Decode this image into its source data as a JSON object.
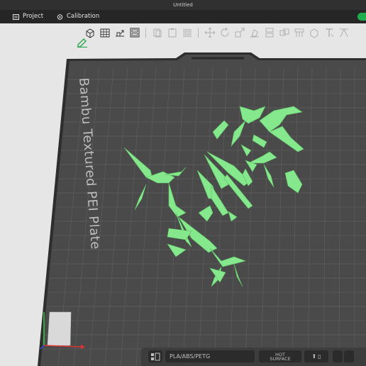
{
  "window": {
    "title": "Untitled"
  },
  "menu": {
    "tabs": [
      {
        "label": "Project",
        "icon": "project-icon"
      },
      {
        "label": "Calibration",
        "icon": "calibration-icon"
      }
    ]
  },
  "toolbar": {
    "icons": [
      "add-cube-icon",
      "grid-icon",
      "arrange-icon",
      "plate-icon",
      "copy-icon",
      "paste-icon",
      "list-icon",
      "move-icon",
      "rotate-icon",
      "scale-icon",
      "lay-on-face-icon",
      "cut-icon",
      "split-icon",
      "support-icon",
      "seam-icon",
      "text-icon",
      "measure-icon"
    ]
  },
  "plate": {
    "label": "Bambu Textured PEI Plate",
    "filament_badge": "PLA/ABS/PETG",
    "surface_badge_line1": "HOT",
    "surface_badge_line2": "SURFACE"
  },
  "colors": {
    "accent": "#1fae4e",
    "model": "#86e88c",
    "plate": "#4a4a4a",
    "grid_line": "#5d5d5d"
  }
}
